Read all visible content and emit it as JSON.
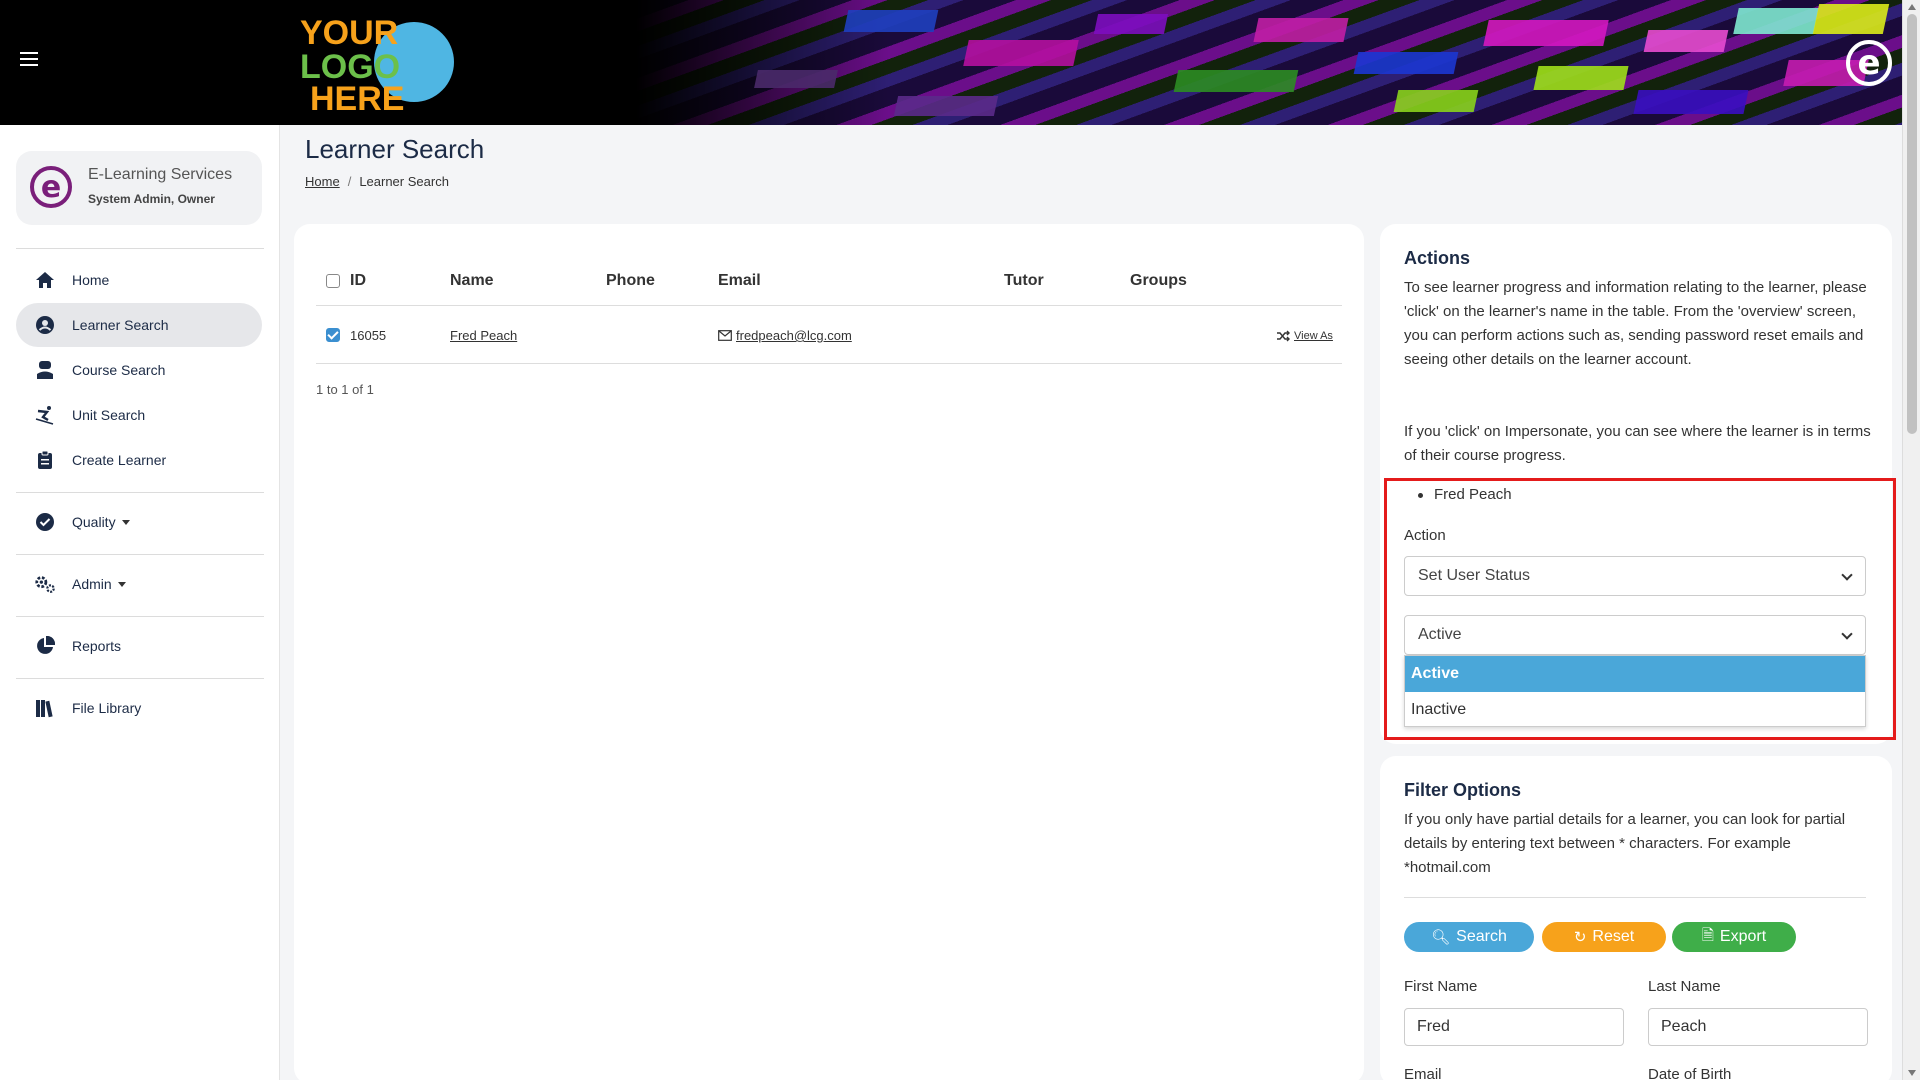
{
  "header": {
    "logo_text_lines": [
      "YOUR",
      "LOGO",
      "HERE"
    ],
    "brand_glyph": "e"
  },
  "sidebar": {
    "profile": {
      "org": "E-Learning Services",
      "role": "System Admin, Owner",
      "avatar_glyph": "e"
    },
    "items": [
      {
        "label": "Home",
        "icon": "home-icon"
      },
      {
        "label": "Learner Search",
        "icon": "user-circle-icon",
        "active": true
      },
      {
        "label": "Course Search",
        "icon": "graduate-icon"
      },
      {
        "label": "Unit Search",
        "icon": "skiing-icon"
      },
      {
        "label": "Create Learner",
        "icon": "clipboard-icon"
      },
      {
        "label": "Quality",
        "icon": "check-circle-icon",
        "dropdown": true
      },
      {
        "label": "Admin",
        "icon": "cogs-icon",
        "dropdown": true
      },
      {
        "label": "Reports",
        "icon": "pie-chart-icon"
      },
      {
        "label": "File Library",
        "icon": "books-icon"
      }
    ]
  },
  "page": {
    "title": "Learner Search",
    "breadcrumb": {
      "home": "Home",
      "current": "Learner Search",
      "separator": "/"
    }
  },
  "table": {
    "columns": [
      "ID",
      "Name",
      "Phone",
      "Email",
      "Tutor",
      "Groups"
    ],
    "rows": [
      {
        "id": "16055",
        "name": "Fred Peach",
        "phone": "",
        "email": "fredpeach@lcg.com",
        "tutor": "",
        "groups": "",
        "action": "View As",
        "checked": true
      }
    ],
    "pager": "1 to 1 of 1"
  },
  "actions": {
    "title": "Actions",
    "para1": "To see learner progress and information relating to the learner, please 'click' on the learner's name in the table. From the 'overview' screen, you can perform actions such as, sending password reset emails and seeing other details on the learner account.",
    "para2": "If you 'click' on Impersonate, you can see where the learner is in terms of their course progress.",
    "selected_learners": [
      "Fred Peach"
    ],
    "action_label": "Action",
    "action_value": "Set User Status",
    "status_value": "Active",
    "status_options": [
      "Active",
      "Inactive"
    ],
    "highlight_color": "#e41b1b"
  },
  "filter": {
    "title": "Filter Options",
    "description": "If you only have partial details for a learner, you can look for partial details by entering text between * characters. For example *hotmail.com",
    "buttons": {
      "search": {
        "label": "Search",
        "color": "#4aa7d9"
      },
      "reset": {
        "label": "Reset",
        "color": "#f7a21b"
      },
      "export": {
        "label": "Export",
        "color": "#3fae49"
      }
    },
    "first_name_label": "First Name",
    "first_name_value": "Fred",
    "last_name_label": "Last Name",
    "last_name_value": "Peach",
    "email_label": "Email",
    "dob_label": "Date of Birth"
  }
}
